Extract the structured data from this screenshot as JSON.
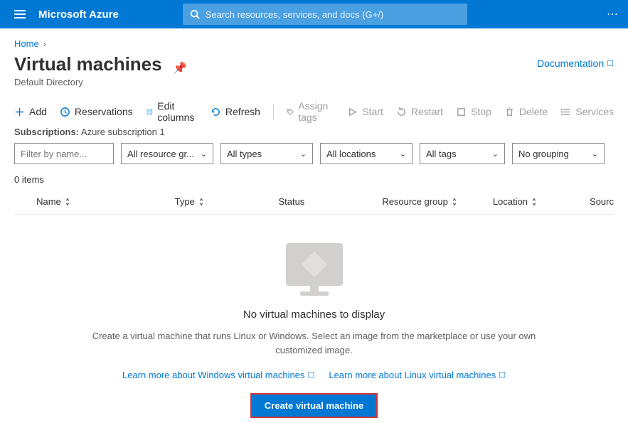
{
  "topbar": {
    "brand": "Microsoft Azure",
    "search_placeholder": "Search resources, services, and docs (G+/)"
  },
  "breadcrumb": {
    "home": "Home"
  },
  "page": {
    "title": "Virtual machines",
    "subtitle": "Default Directory",
    "doc_link": "Documentation"
  },
  "toolbar": {
    "add": "Add",
    "reservations": "Reservations",
    "edit_columns": "Edit columns",
    "refresh": "Refresh",
    "assign_tags": "Assign tags",
    "start": "Start",
    "restart": "Restart",
    "stop": "Stop",
    "delete": "Delete",
    "services": "Services"
  },
  "subscriptions": {
    "label": "Subscriptions:",
    "value": "Azure subscription 1"
  },
  "filters": {
    "name_placeholder": "Filter by name...",
    "resource_groups": "All resource gr...",
    "types": "All types",
    "locations": "All locations",
    "tags": "All tags",
    "grouping": "No grouping"
  },
  "table": {
    "count": "0 items",
    "cols": {
      "name": "Name",
      "type": "Type",
      "status": "Status",
      "resource_group": "Resource group",
      "location": "Location",
      "source": "Sourc"
    }
  },
  "empty": {
    "heading": "No virtual machines to display",
    "desc": "Create a virtual machine that runs Linux or Windows. Select an image from the marketplace or use your own customized image.",
    "learn_windows": "Learn more about Windows virtual machines",
    "learn_linux": "Learn more about Linux virtual machines",
    "create_btn": "Create virtual machine"
  }
}
